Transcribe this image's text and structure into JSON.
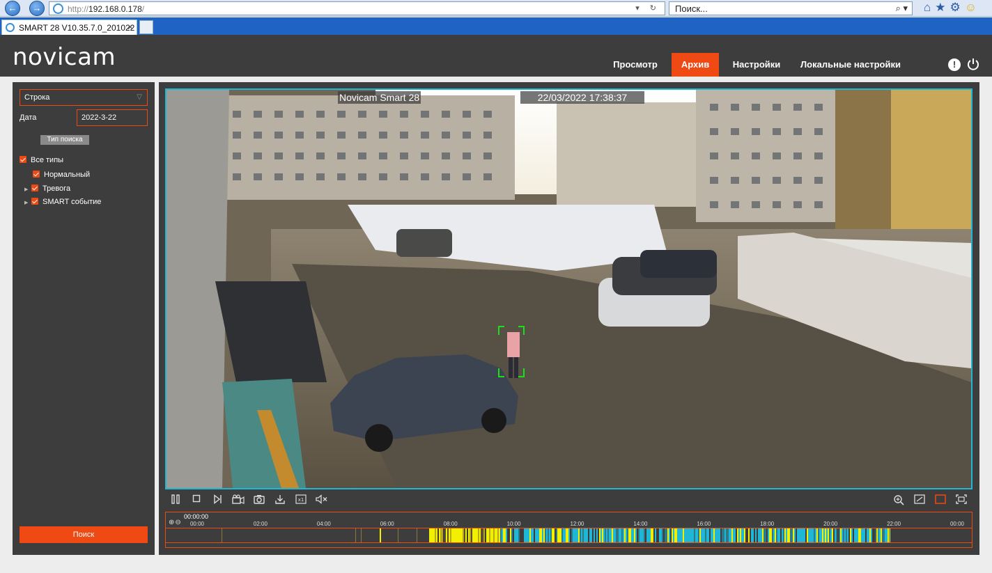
{
  "browser": {
    "url_prefix": "http://",
    "url_host": "192.168.0.178",
    "url_suffix": "/",
    "search_placeholder": "Поиск...",
    "tab_title": "SMART 28 V10.35.7.0_201022",
    "tab_close": "✕"
  },
  "header": {
    "logo": "novicam",
    "menu": [
      {
        "label": "Просмотр",
        "active": false
      },
      {
        "label": "Архив",
        "active": true
      },
      {
        "label": "Настройки",
        "active": false
      },
      {
        "label": "Локальные настройки",
        "active": false
      }
    ],
    "info_glyph": "!"
  },
  "sidebar": {
    "search_mode": "Строка",
    "date_label": "Дата",
    "date_value": "2022-3-22",
    "search_type_button": "Тип поиска",
    "types": {
      "all": "Все типы",
      "normal": "Нормальный",
      "alarm": "Тревога",
      "smart": "SMART событие"
    },
    "search_button": "Поиск"
  },
  "player": {
    "osd_name": "Novicam Smart 28",
    "osd_time": "22/03/2022 17:38:37",
    "speed_label": "x1"
  },
  "timeline": {
    "cursor_time": "00:00:00",
    "ticks": [
      "00:00",
      "02:00",
      "04:00",
      "06:00",
      "08:00",
      "10:00",
      "12:00",
      "14:00",
      "16:00",
      "18:00",
      "20:00",
      "22:00",
      "00:00"
    ],
    "colors": {
      "normal": "#20b6d6",
      "alarm": "#f0f000",
      "smart": "#2a7a8a"
    }
  },
  "colors": {
    "accent": "#f04a14",
    "panel": "#3d3d3d",
    "video_border": "#20b6d6"
  }
}
